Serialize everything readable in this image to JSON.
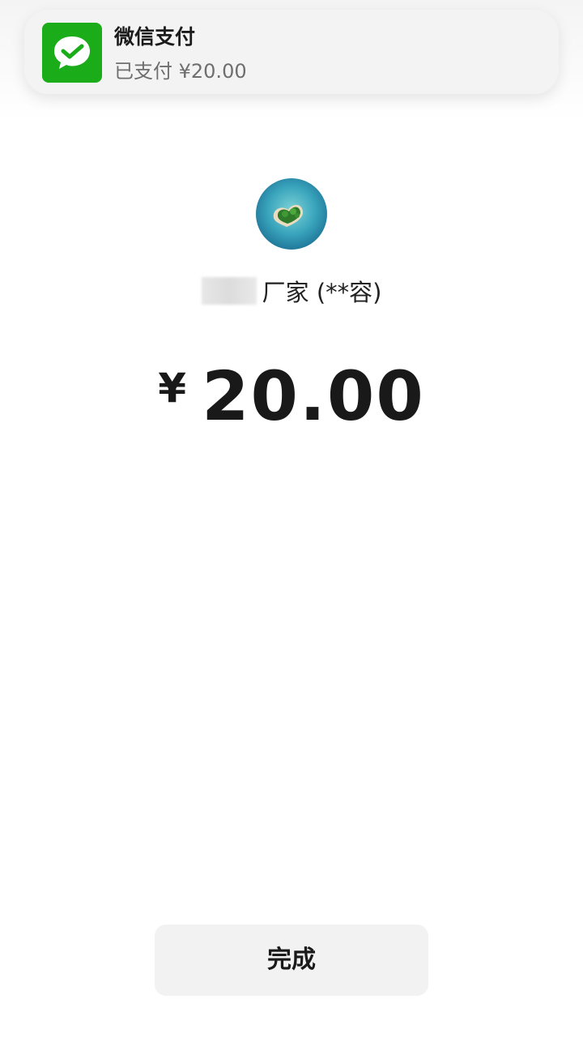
{
  "notification": {
    "app_name": "微信支付",
    "message": "已支付 ¥20.00",
    "icon": "wechat-pay-check-icon",
    "accent_color": "#1AAD19"
  },
  "payment": {
    "avatar": "heart-island-avatar",
    "merchant_name": "厂家 (**容)",
    "currency_symbol": "¥",
    "amount": "20.00"
  },
  "actions": {
    "done_label": "完成"
  }
}
